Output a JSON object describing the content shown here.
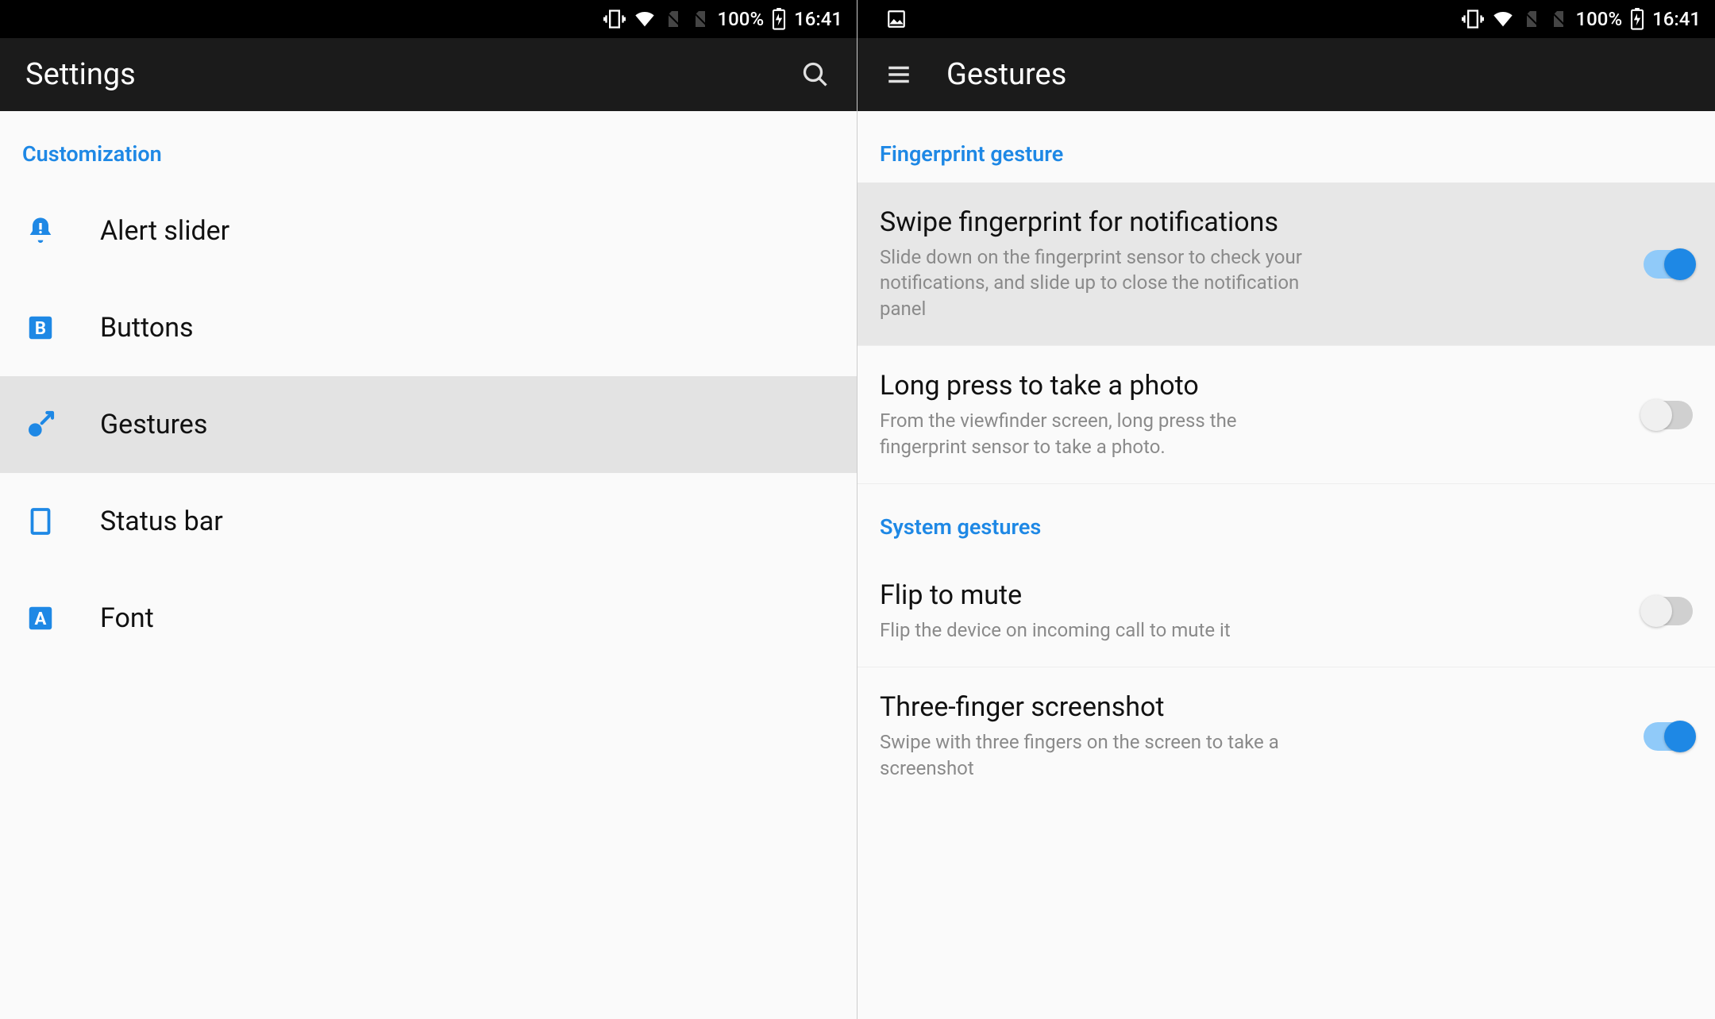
{
  "status": {
    "battery_pct": "100%",
    "time": "16:41"
  },
  "left": {
    "title": "Settings",
    "section": "Customization",
    "items": [
      {
        "label": "Alert slider"
      },
      {
        "label": "Buttons"
      },
      {
        "label": "Gestures"
      },
      {
        "label": "Status bar"
      },
      {
        "label": "Font"
      }
    ]
  },
  "right": {
    "title": "Gestures",
    "sections": [
      {
        "header": "Fingerprint gesture",
        "prefs": [
          {
            "title": "Swipe fingerprint for notifications",
            "sub": "Slide down on the fingerprint sensor to check your notifications, and slide up to close the notification panel",
            "on": true
          },
          {
            "title": "Long press to take a photo",
            "sub": "From the viewfinder screen, long press the fingerprint sensor to take a photo.",
            "on": false
          }
        ]
      },
      {
        "header": "System gestures",
        "prefs": [
          {
            "title": "Flip to mute",
            "sub": "Flip the device on incoming call to mute it",
            "on": false
          },
          {
            "title": "Three-finger screenshot",
            "sub": "Swipe with three fingers on the screen to take a screenshot",
            "on": true
          }
        ]
      }
    ]
  }
}
